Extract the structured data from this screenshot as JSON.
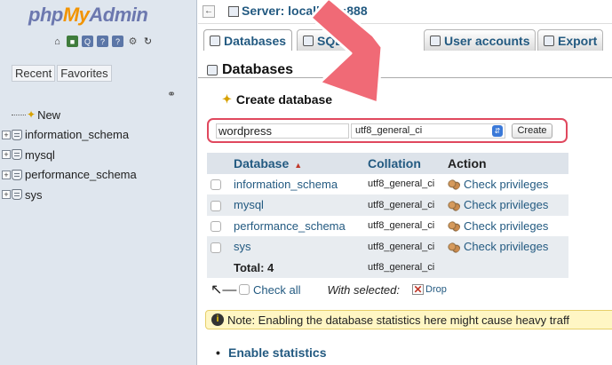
{
  "nav": {
    "logo": {
      "php": "php",
      "my": "My",
      "admin": "Admin"
    },
    "icons": [
      "home-icon",
      "logout-icon",
      "query-window-icon",
      "docs-icon",
      "sql-docs-icon",
      "settings-icon",
      "reload-icon"
    ],
    "tabs": [
      "Recent",
      "Favorites"
    ],
    "link_icon": "⚭",
    "tree": [
      {
        "label": "New",
        "kind": "new"
      },
      {
        "label": "information_schema",
        "kind": "db"
      },
      {
        "label": "mysql",
        "kind": "db"
      },
      {
        "label": "performance_schema",
        "kind": "db"
      },
      {
        "label": "sys",
        "kind": "db"
      }
    ]
  },
  "breadcrumb": {
    "collapse": "←",
    "server": "Server: localhost:888"
  },
  "topmenu": {
    "tabs": [
      {
        "label": "Databases",
        "active": true
      },
      {
        "label": "SQL",
        "active": false
      },
      {
        "label": "User accounts",
        "active": false
      },
      {
        "label": "Export",
        "active": false
      }
    ]
  },
  "page": {
    "heading": "Databases",
    "create_heading": "Create database",
    "db_name_value": "wordpress",
    "collation_value": "utf8_general_ci",
    "create_button": "Create"
  },
  "table": {
    "headers": [
      "Database",
      "Collation",
      "Action"
    ],
    "sort_indicator": "▲",
    "rows": [
      {
        "name": "information_schema",
        "collation": "utf8_general_ci",
        "action": "Check privileges"
      },
      {
        "name": "mysql",
        "collation": "utf8_general_ci",
        "action": "Check privileges"
      },
      {
        "name": "performance_schema",
        "collation": "utf8_general_ci",
        "action": "Check privileges"
      },
      {
        "name": "sys",
        "collation": "utf8_general_ci",
        "action": "Check privileges"
      }
    ],
    "total_label": "Total: 4",
    "total_collation": "utf8_general_ci"
  },
  "bulk": {
    "check_all": "Check all",
    "with_selected": "With selected:",
    "drop": "Drop"
  },
  "notice": {
    "text": "Note: Enabling the database statistics here might cause heavy traff"
  },
  "enable_stats": "Enable statistics",
  "colors": {
    "link": "#235a81",
    "highlight": "#e0485e",
    "arrow": "#f06a76",
    "nav_bg": "#dfe6ee"
  }
}
